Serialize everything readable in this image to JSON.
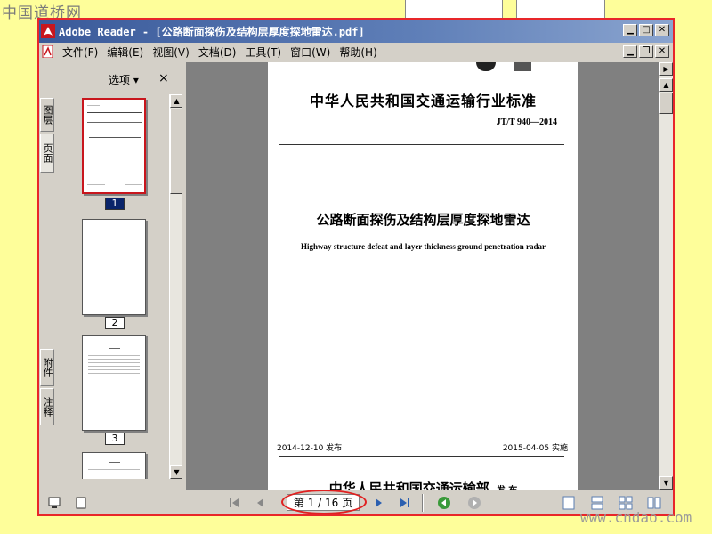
{
  "watermark": {
    "top": "中国道桥网",
    "bottom": "www.cndao.com"
  },
  "window": {
    "title": "Adobe Reader - [公路断面探伤及结构层厚度探地雷达.pdf]"
  },
  "menu": {
    "items": [
      "文件(F)",
      "编辑(E)",
      "视图(V)",
      "文档(D)",
      "工具(T)",
      "窗口(W)",
      "帮助(H)"
    ]
  },
  "side_tabs": [
    "图层",
    "页面",
    "附件",
    "注释"
  ],
  "thumbnails": {
    "options_label": "选项",
    "close_symbol": "×",
    "pages": [
      {
        "label": "1",
        "selected": true
      },
      {
        "label": "2",
        "selected": false
      },
      {
        "label": "3",
        "selected": false
      }
    ]
  },
  "document": {
    "standard_title": "中华人民共和国交通运输行业标准",
    "standard_code": "JT/T 940—2014",
    "title_cn": "公路断面探伤及结构层厚度探地雷达",
    "title_en": "Highway structure defeat and layer thickness ground penetration radar",
    "issue_date": "2014-12-10 发布",
    "implement_date": "2015-04-05 实施",
    "issuer": "中华人民共和国交通运输部",
    "issuer_suffix": "发 布"
  },
  "status": {
    "page_indicator": "第 1 / 16 页"
  },
  "colors": {
    "highlight_red": "#e8262a",
    "title_blue": "#3a5a9a",
    "background_yellow": "#fefe9a"
  }
}
